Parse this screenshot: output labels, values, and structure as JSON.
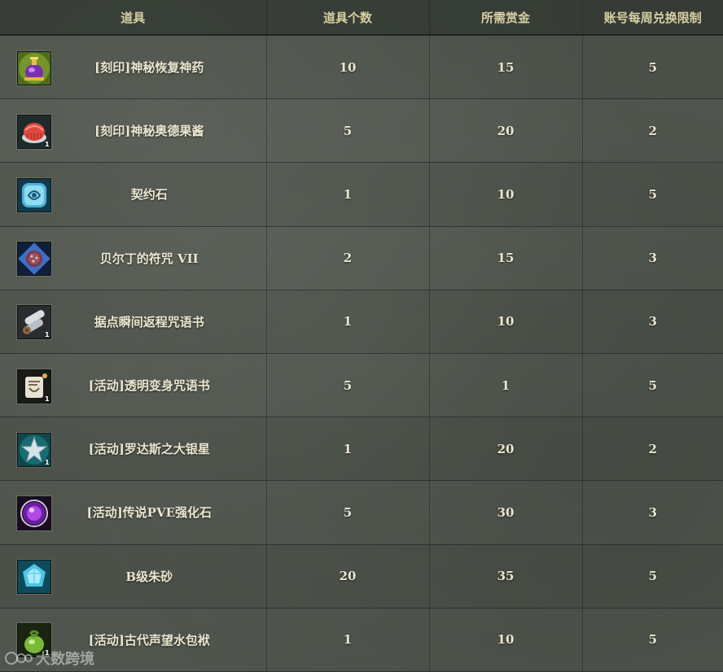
{
  "table": {
    "headers": {
      "item": "道具",
      "quantity": "道具个数",
      "bounty": "所需赏金",
      "limit": "账号每周兑换限制"
    },
    "rows": [
      {
        "icon": "purple-potion-icon",
        "name": "[刻印]神秘恢复神药",
        "quantity": "10",
        "bounty": "15",
        "limit": "5"
      },
      {
        "icon": "red-jelly-icon",
        "name": "[刻印]神秘奥德果酱",
        "quantity": "5",
        "bounty": "20",
        "limit": "2",
        "icon_badge": "1"
      },
      {
        "icon": "contract-stone-icon",
        "name": "契约石",
        "quantity": "1",
        "bounty": "10",
        "limit": "5"
      },
      {
        "icon": "charm-icon",
        "name": "贝尔丁的符咒 VII",
        "quantity": "2",
        "bounty": "15",
        "limit": "3"
      },
      {
        "icon": "scroll-icon",
        "name": "据点瞬间返程咒语书",
        "quantity": "1",
        "bounty": "10",
        "limit": "3",
        "icon_badge": "1"
      },
      {
        "icon": "transform-scroll-icon",
        "name": "[活动]透明变身咒语书",
        "quantity": "5",
        "bounty": "1",
        "limit": "5",
        "icon_badge": "1"
      },
      {
        "icon": "silver-star-icon",
        "name": "[活动]罗达斯之大银星",
        "quantity": "1",
        "bounty": "20",
        "limit": "2",
        "icon_badge": "1"
      },
      {
        "icon": "purple-orb-icon",
        "name": "[活动]传说PVE强化石",
        "quantity": "5",
        "bounty": "30",
        "limit": "3"
      },
      {
        "icon": "cinnabar-icon",
        "name": "B级朱砂",
        "quantity": "20",
        "bounty": "35",
        "limit": "5"
      },
      {
        "icon": "water-pouch-icon",
        "name": "[活动]古代声望水包袱",
        "quantity": "1",
        "bounty": "10",
        "limit": "5",
        "icon_badge": "1"
      }
    ]
  },
  "watermark": {
    "text": "大数跨境"
  },
  "colors": {
    "background": "#4b5149",
    "header_text": "#d8cfa2",
    "cell_text": "#ece6cf"
  }
}
